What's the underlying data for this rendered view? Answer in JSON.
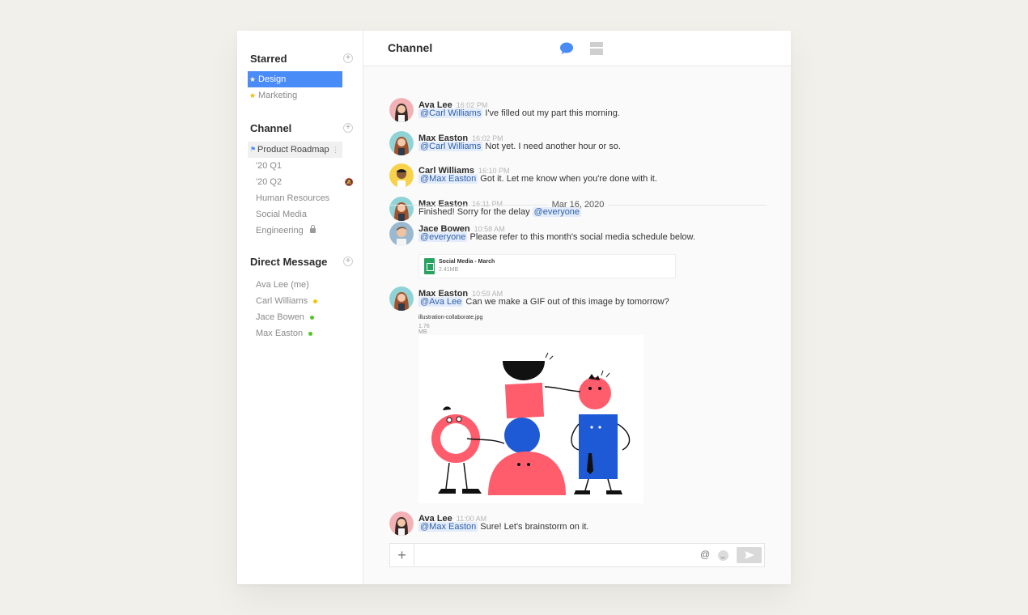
{
  "sidebar": {
    "starred": {
      "title": "Starred",
      "items": [
        {
          "label": "Design"
        },
        {
          "label": "Marketing"
        }
      ]
    },
    "channel": {
      "title": "Channel",
      "items": [
        {
          "label": "Product Roadmap"
        },
        {
          "label": "'20 Q1"
        },
        {
          "label": "'20 Q2"
        },
        {
          "label": "Human Resources"
        },
        {
          "label": "Social Media"
        },
        {
          "label": "Engineering"
        }
      ]
    },
    "direct": {
      "title": "Direct Message",
      "items": [
        {
          "label": "Ava Lee (me)",
          "status": ""
        },
        {
          "label": "Carl Williams",
          "status": "#f5c400"
        },
        {
          "label": "Jace Bowen",
          "status": "#57c425"
        },
        {
          "label": "Max Easton",
          "status": "#57c425"
        }
      ]
    }
  },
  "header": {
    "title": "Channel"
  },
  "messages": [
    {
      "name": "Ava Lee",
      "time": "16:02 PM",
      "mention": "@Carl Williams",
      "text": " I've filled out my part this morning."
    },
    {
      "name": "Max Easton",
      "time": "16:02 PM",
      "mention": "@Carl Williams",
      "text": " Not yet. I need another hour or so."
    },
    {
      "name": "Carl Williams",
      "time": "16:10 PM",
      "mention": "@Max Easton",
      "text": " Got it. Let me know when you're done with it."
    },
    {
      "name": "Max Easton",
      "time": "16:11 PM",
      "text": "Finished! Sorry for the delay ",
      "mention_after": "@everyone"
    },
    {
      "name": "Jace Bowen",
      "time": "10:58 AM",
      "mention": "@everyone",
      "text": " Please refer to this month's social media schedule below."
    },
    {
      "name": "Max Easton",
      "time": "10:59 AM",
      "mention": "@Ava Lee",
      "text": " Can we make a GIF out of this image by tomorrow?"
    },
    {
      "name": "Ava Lee",
      "time": "11:00 AM",
      "mention": "@Max Easton",
      "text": " Sure! Let's brainstorm on it."
    }
  ],
  "date_divider": "Mar 16, 2020",
  "attachment_file": {
    "name": "Social Media - March",
    "size": "2.41MB"
  },
  "attachment_image": {
    "name": "illustration-collaborate.jpg",
    "size": "1.76 MB"
  },
  "composer": {
    "placeholder": "",
    "at_symbol": "@"
  },
  "colors": {
    "accent": "#4a8cf7",
    "mention_bg": "#e3ecfb"
  }
}
